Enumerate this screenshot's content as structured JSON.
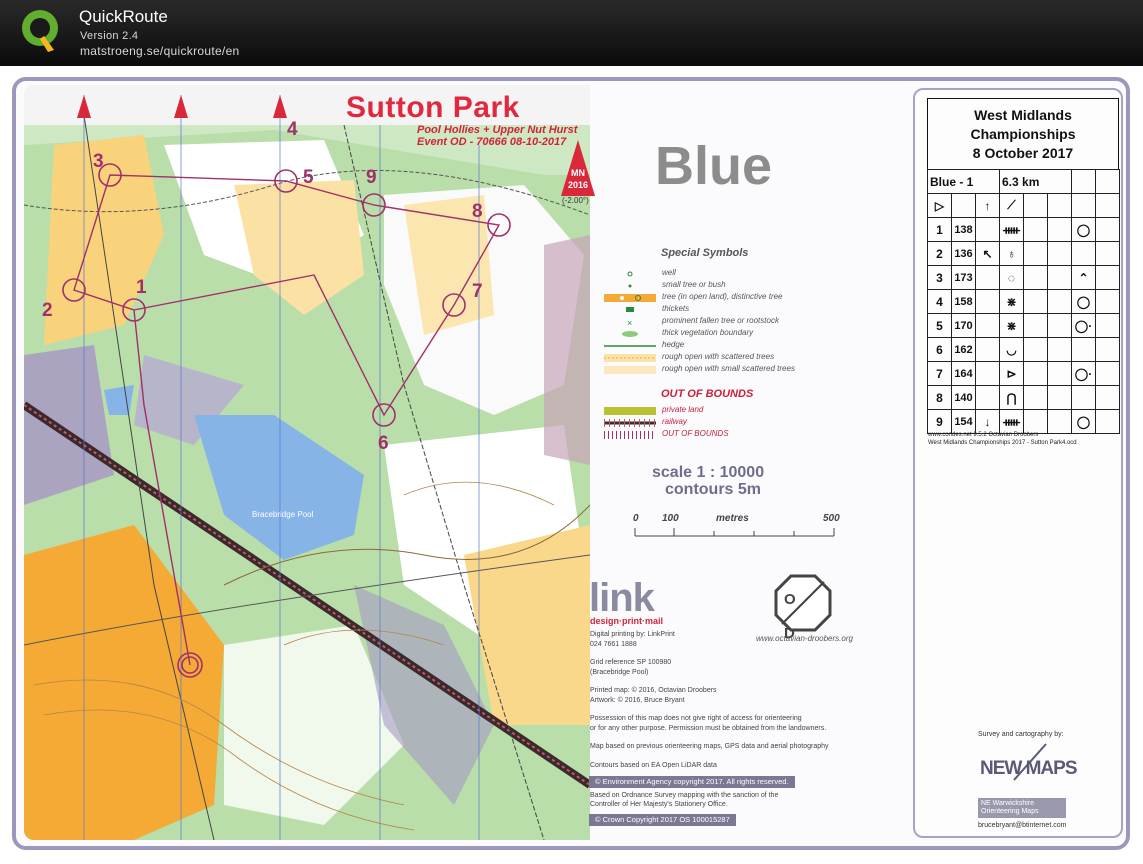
{
  "app": {
    "title": "QuickRoute",
    "version": "Version 2.4",
    "url": "matstroeng.se/quickroute/en"
  },
  "map": {
    "title": "Sutton Park",
    "subtitle": "Pool Hollies + Upper Nut Hurst",
    "event": "Event OD - 70666  08-10-2017",
    "mn_label": "MN",
    "mn_year": "2016",
    "declination": "(-2.00°)",
    "course_name": "Blue",
    "place_label": "Bracebridge Pool",
    "control_numbers": [
      "1",
      "2",
      "3",
      "4",
      "5",
      "6",
      "7",
      "8",
      "9"
    ]
  },
  "legend": {
    "title": "Special Symbols",
    "items": [
      "well",
      "small tree or bush",
      "tree (in open land), distinctive tree",
      "thickets",
      "prominent fallen tree or rootstock",
      "thick vegetation boundary",
      "hedge",
      "rough open with scattered trees",
      "rough open with small scattered trees"
    ],
    "oob_title": "OUT OF BOUNDS",
    "oob_items": [
      "private land",
      "railway",
      "OUT OF BOUNDS"
    ]
  },
  "scale": {
    "scale_text": "scale 1 : 10000",
    "contours_text": "contours 5m",
    "bar_labels": [
      "0",
      "100",
      "metres",
      "500"
    ]
  },
  "credits": {
    "link_logo": "link",
    "link_tagline": "design·print·mail",
    "lines": [
      "Digital printing by: LinkPrint",
      "024 7661 1888",
      "Grid reference SP 100980",
      "(Bracebridge Pool)",
      "Printed map: © 2016, Octavian Droobers",
      "Artwork: © 2016, Bruce Bryant",
      "Possession of this map does not give right of access for orienteering",
      "or for any other purpose. Permission must be obtained from the landowners.",
      "Map based on previous orienteering maps, GPS data and aerial photography",
      "Contours based on EA Open LiDAR data",
      "Based on Ordnance Survey mapping with the sanction of the",
      "Controller of Her Majesty's Stationery Office."
    ],
    "box_env": "© Environment Agency copyright 2017. All rights reserved.",
    "box_crown": "© Crown Copyright 2017 OS 100015287",
    "od_letters": "O D",
    "od_url": "www.octavian-droobers.org"
  },
  "descriptions": {
    "event_line1": "West Midlands",
    "event_line2": "Championships",
    "event_line3": "8 October 2017",
    "course": "Blue - 1",
    "length": "6.3 km",
    "start_symbol": "▷",
    "start_direction": "↑",
    "start_feature": "⟋",
    "rows": [
      {
        "num": "1",
        "code": "138",
        "dir": "",
        "feature": "ᚔ",
        "pos": "◯"
      },
      {
        "num": "2",
        "code": "136",
        "dir": "↖",
        "feature": "♁",
        "pos": ""
      },
      {
        "num": "3",
        "code": "173",
        "dir": "",
        "feature": "◌",
        "pos": "⌃"
      },
      {
        "num": "4",
        "code": "158",
        "dir": "",
        "feature": "⋇",
        "pos": "◯"
      },
      {
        "num": "5",
        "code": "170",
        "dir": "",
        "feature": "⋇",
        "pos": "◯·"
      },
      {
        "num": "6",
        "code": "162",
        "dir": "",
        "feature": "◡",
        "pos": ""
      },
      {
        "num": "7",
        "code": "164",
        "dir": "",
        "feature": "⊳",
        "pos": "◯·"
      },
      {
        "num": "8",
        "code": "140",
        "dir": "",
        "feature": "⋂",
        "pos": ""
      },
      {
        "num": "9",
        "code": "154",
        "dir": "↓",
        "feature": "ᚔ",
        "pos": "◯"
      }
    ],
    "footer1": "www.condes.net 9.5.2 Octavian Droobers",
    "footer2": "West Midlands Championships 2017 - Sutton Park4.ocd"
  },
  "survey": {
    "label": "Survey and cartography by:",
    "logo": "NEW MAPS",
    "sub1": "NE Warwickshire",
    "sub2": "Orienteering Maps",
    "email": "brucebryant@btinternet.com"
  },
  "colors": {
    "course_magenta": "#a0306a",
    "title_red": "#e0283f",
    "forest_white": "#ffffff",
    "green": "#6db863",
    "open_yellow": "#f7b53c",
    "water_blue": "#86b4e6",
    "oob_purple": "#a79ac6"
  }
}
